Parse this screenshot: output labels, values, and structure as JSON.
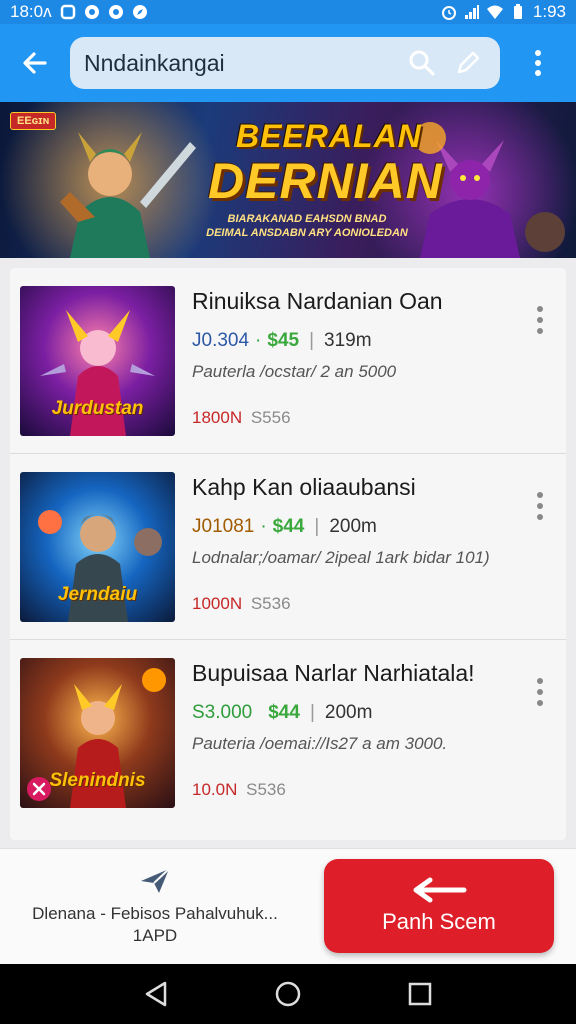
{
  "status_bar": {
    "time_left": "18:0ʌ",
    "time_right": "1:93",
    "icons": [
      "square-icon",
      "record-icon",
      "record-icon",
      "compass-icon",
      "alarm-icon",
      "signal-icon",
      "wifi-icon",
      "battery-icon"
    ]
  },
  "app_bar": {
    "search_value": "Nndainkangai",
    "back_icon": "arrow-left-icon",
    "search_icon": "search-icon",
    "edit_icon": "pen-icon",
    "menu_icon": "more-vert-icon"
  },
  "banner": {
    "tag": "EEɢɪɴ",
    "title_line1": "BEERALAN",
    "title_line2": "DERNIAN",
    "subtitle_line1": "BIARAKANAD EAHSDN BNAD",
    "subtitle_line2": "DEIMAL ANSDABN ARY AONIOLEDAN"
  },
  "list_items": [
    {
      "title": "Rinuiksa Nardanian Oan",
      "stat_a": "J0.304",
      "stat_b": "$45",
      "stat_c": "319m",
      "description": "Pauterla /ocstar/ 2 an 5000",
      "meta_a": "1800N",
      "meta_b": "S556",
      "thumb_caption": "Jurdustan"
    },
    {
      "title": "Kahp Kan oliaaubansi",
      "stat_a": "J01081",
      "stat_b": "$44",
      "stat_c": "200m",
      "description": "Lodnalar;/oamar/ 2ipeal 1ark bidar 101)",
      "meta_a": "1000N",
      "meta_b": "S536",
      "thumb_caption": "Jerndaiu"
    },
    {
      "title": "Bupuisaa Narlar Narhiatala!",
      "stat_a": "S3.000",
      "stat_b": "$44",
      "stat_c": "200m",
      "description": "Pauteria /oemai://Is27 a am 3000.",
      "meta_a": "10.0N",
      "meta_b": "S536",
      "thumb_caption": "Slenindnis"
    }
  ],
  "action_bar": {
    "share_label_line1": "Dlenana - Febisos Pahalvuhuk...",
    "share_label_line2": "1APD",
    "primary_label": "Panh Scem"
  },
  "colors": {
    "app_bar": "#2196f3",
    "primary_button": "#de1f2a",
    "price_green": "#3aa83d",
    "meta_red": "#c62828",
    "link_blue": "#2c58a6"
  }
}
